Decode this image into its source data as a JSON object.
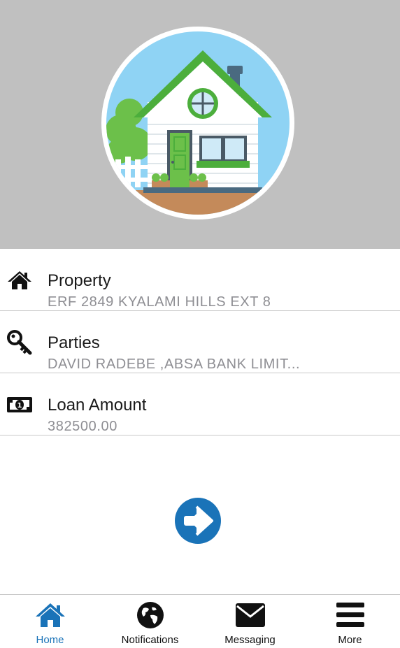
{
  "hero": {
    "illustration": "house-illustration"
  },
  "rows": [
    {
      "icon": "home-icon",
      "title": "Property",
      "value": "ERF 2849 KYALAMI HILLS EXT 8"
    },
    {
      "icon": "key-icon",
      "title": "Parties",
      "value": "DAVID RADEBE ,ABSA BANK LIMIT..."
    },
    {
      "icon": "banknote-icon",
      "title": "Loan Amount",
      "value": "382500.00"
    }
  ],
  "next_button": {
    "icon": "arrow-right-circle-icon"
  },
  "tabs": [
    {
      "icon": "home-icon",
      "label": "Home",
      "active": true
    },
    {
      "icon": "globe-icon",
      "label": "Notifications",
      "active": false
    },
    {
      "icon": "envelope-icon",
      "label": "Messaging",
      "active": false
    },
    {
      "icon": "menu-icon",
      "label": "More",
      "active": false
    }
  ],
  "colors": {
    "hero_background": "#c0c0c0",
    "accent_blue": "#1a73b8",
    "value_gray": "#8e8e93",
    "house_green": "#4cae3c",
    "sky_blue": "#8fd3f4"
  }
}
